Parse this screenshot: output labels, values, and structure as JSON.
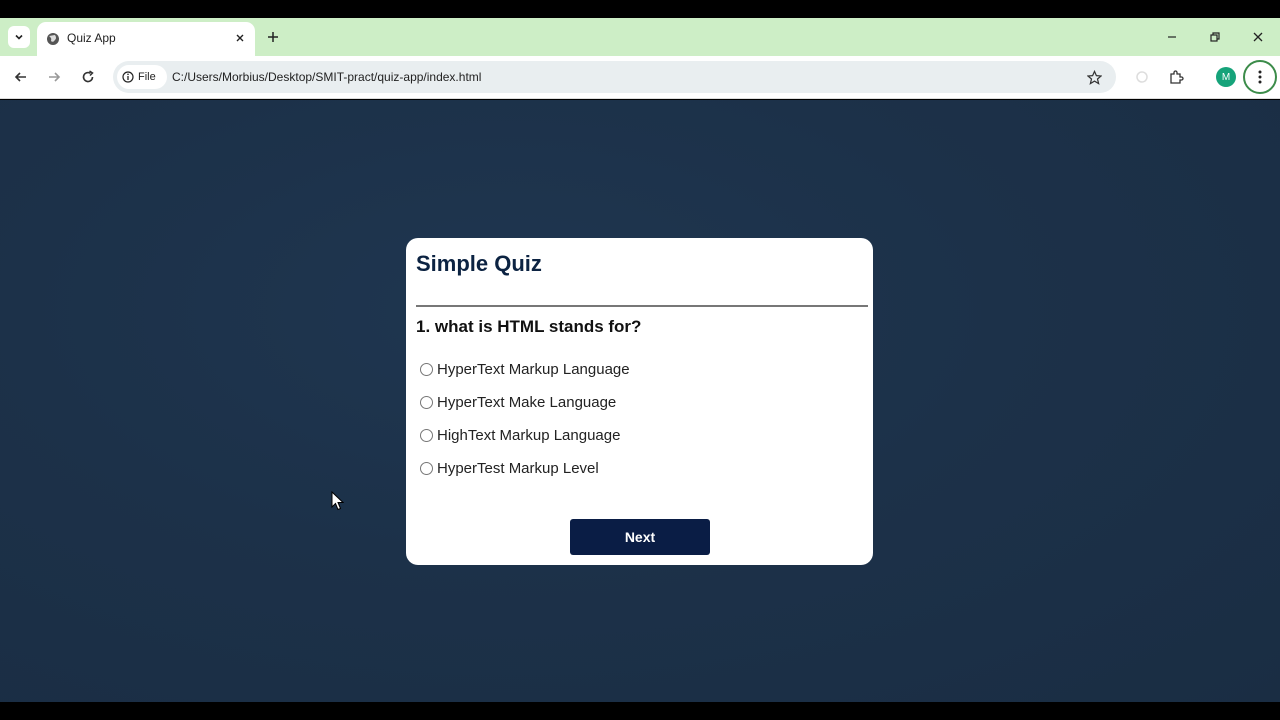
{
  "browser": {
    "tab_title": "Quiz App",
    "site_chip_label": "File",
    "url": "C:/Users/Morbius/Desktop/SMIT-pract/quiz-app/index.html",
    "profile_initial": "M"
  },
  "quiz": {
    "title": "Simple Quiz",
    "question": "1. what is HTML stands for?",
    "options": [
      "HyperText Markup Language",
      "HyperText Make Language",
      "HighText Markup Language",
      "HyperTest Markup Level"
    ],
    "next_label": "Next"
  },
  "colors": {
    "tabstrip_bg": "#cdeec6",
    "page_bg": "#1c3149",
    "card_title": "#0c2342",
    "button_bg": "#0a1d45",
    "avatar_bg": "#16a37a"
  },
  "icons": [
    "tab-search-icon",
    "globe-icon",
    "close-icon",
    "plus-icon",
    "minimize-icon",
    "restore-icon",
    "back-icon",
    "forward-icon",
    "reload-icon",
    "info-icon",
    "star-icon",
    "extension-icon",
    "more-vert-icon",
    "cursor-icon"
  ]
}
